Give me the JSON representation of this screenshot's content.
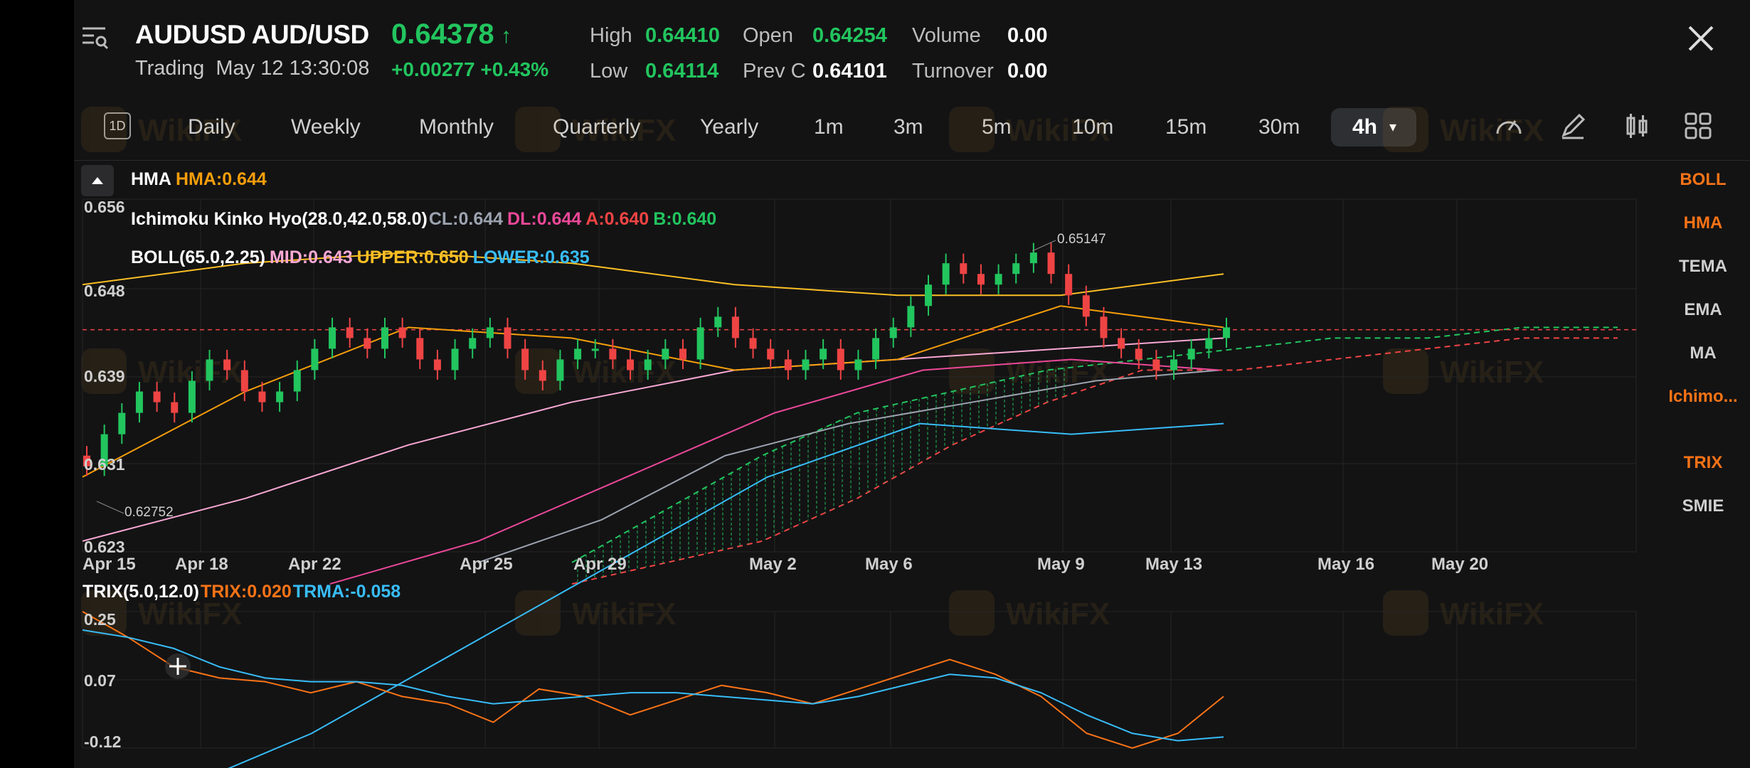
{
  "header": {
    "symbol": "AUDUSD AUD/USD",
    "price": "0.64378",
    "status": "Trading",
    "datetime": "May 12 13:30:08",
    "change": "+0.00277 +0.43%",
    "stats": {
      "high_label": "High",
      "high": "0.64410",
      "open_label": "Open",
      "open": "0.64254",
      "volume_label": "Volume",
      "volume": "0.00",
      "low_label": "Low",
      "low": "0.64114",
      "prevc_label": "Prev C",
      "prevc": "0.64101",
      "turnover_label": "Turnover",
      "turnover": "0.00"
    }
  },
  "tabs": {
    "d1_badge": "1D",
    "items": [
      "Daily",
      "Weekly",
      "Monthly",
      "Quarterly",
      "Yearly",
      "1m",
      "3m",
      "5m",
      "10m",
      "15m",
      "30m"
    ],
    "active": "4h"
  },
  "indicators": {
    "hma_name": "HMA",
    "hma_val": "HMA:0.644",
    "ichi_name": "Ichimoku Kinko Hyo(28.0,42.0,58.0)",
    "ichi_cl": "CL:0.644",
    "ichi_dl": "DL:0.644",
    "ichi_a": "A:0.640",
    "ichi_b": "B:0.640",
    "boll_name": "BOLL(65.0,2.25)",
    "boll_mid": "MID:0.643",
    "boll_upper": "UPPER:0.650",
    "boll_lower": "LOWER:0.635",
    "trix_name": "TRIX(5.0,12.0)",
    "trix_val": "TRIX:0.020",
    "trma_val": "TRMA:-0.058"
  },
  "main_chart": {
    "y_ticks": [
      "0.656",
      "0.648",
      "0.639",
      "0.631",
      "0.623"
    ],
    "x_ticks": [
      "Apr 15",
      "Apr 18",
      "Apr 22",
      "Apr 25",
      "Apr 29",
      "May 2",
      "May 6",
      "May 9",
      "May 13",
      "May 16",
      "May 20"
    ],
    "high_marker": "0.65147",
    "low_marker": "0.62752",
    "current_price_line": 0.64378
  },
  "trix_chart": {
    "y_ticks": [
      "0.25",
      "0.07",
      "-0.12"
    ]
  },
  "sidebar": {
    "items": [
      {
        "label": "BOLL",
        "active": true
      },
      {
        "label": "HMA",
        "active": true
      },
      {
        "label": "TEMA",
        "active": false
      },
      {
        "label": "EMA",
        "active": false
      },
      {
        "label": "MA",
        "active": false
      },
      {
        "label": "Ichimo...",
        "active": true
      },
      {
        "label": "TRIX",
        "active": true
      },
      {
        "label": "SMIE",
        "active": false
      }
    ]
  },
  "colors": {
    "up": "#22c55e",
    "down": "#ef4444",
    "accent": "#f97316",
    "hma": "#f59e0b",
    "cl": "#9ca3af",
    "dl": "#ec4899",
    "a": "#ef4444",
    "b": "#22c55e",
    "mid": "#f9a8d4",
    "upper": "#fbbf24",
    "lower": "#38bdf8",
    "trix": "#f97316",
    "trma": "#38bdf8"
  },
  "chart_data": [
    {
      "type": "line",
      "title": "AUDUSD 4h",
      "ylim": [
        0.623,
        0.656
      ],
      "candles_close": [
        0.631,
        0.634,
        0.636,
        0.638,
        0.637,
        0.636,
        0.639,
        0.641,
        0.64,
        0.638,
        0.637,
        0.638,
        0.64,
        0.642,
        0.644,
        0.643,
        0.642,
        0.644,
        0.643,
        0.641,
        0.64,
        0.642,
        0.643,
        0.644,
        0.642,
        0.64,
        0.639,
        0.641,
        0.642,
        0.642,
        0.641,
        0.64,
        0.641,
        0.642,
        0.641,
        0.644,
        0.645,
        0.643,
        0.642,
        0.641,
        0.64,
        0.641,
        0.642,
        0.64,
        0.641,
        0.643,
        0.644,
        0.646,
        0.648,
        0.65,
        0.649,
        0.648,
        0.649,
        0.65,
        0.651,
        0.649,
        0.647,
        0.645,
        0.643,
        0.642,
        0.641,
        0.64,
        0.641,
        0.642,
        0.643,
        0.644
      ],
      "series": [
        {
          "name": "BOLL UPPER",
          "values": [
            0.648,
            0.65,
            0.651,
            0.65,
            0.648,
            0.647,
            0.647,
            0.649
          ]
        },
        {
          "name": "BOLL MID",
          "values": [
            0.624,
            0.628,
            0.633,
            0.637,
            0.64,
            0.641,
            0.642,
            0.643
          ]
        },
        {
          "name": "BOLL LOWER",
          "values": [
            0.6,
            0.606,
            0.614,
            0.622,
            0.63,
            0.635,
            0.634,
            0.635
          ]
        },
        {
          "name": "HMA",
          "values": [
            0.63,
            0.638,
            0.644,
            0.643,
            0.64,
            0.641,
            0.646,
            0.644
          ]
        }
      ]
    },
    {
      "type": "line",
      "title": "TRIX(5.0,12.0)",
      "ylim": [
        -0.12,
        0.25
      ],
      "series": [
        {
          "name": "TRIX",
          "values": [
            0.25,
            0.18,
            0.1,
            0.07,
            0.06,
            0.03,
            0.06,
            0.02,
            0.0,
            -0.05,
            0.04,
            0.02,
            -0.03,
            0.01,
            0.05,
            0.03,
            0.0,
            0.04,
            0.08,
            0.12,
            0.08,
            0.02,
            -0.08,
            -0.12,
            -0.08,
            0.02
          ]
        },
        {
          "name": "TRMA",
          "values": [
            0.2,
            0.18,
            0.15,
            0.1,
            0.07,
            0.06,
            0.06,
            0.05,
            0.02,
            0.0,
            0.01,
            0.02,
            0.03,
            0.03,
            0.02,
            0.01,
            0.0,
            0.02,
            0.05,
            0.08,
            0.07,
            0.03,
            -0.03,
            -0.08,
            -0.1,
            -0.09
          ]
        }
      ]
    }
  ]
}
